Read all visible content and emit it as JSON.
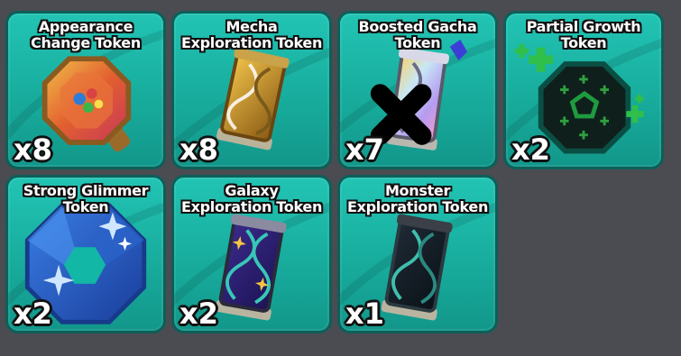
{
  "inventory": {
    "items": [
      {
        "name_line1": "Appearance",
        "name_line2": "Change Token",
        "count": "x8",
        "icon": "rainbow-octagon-token-icon"
      },
      {
        "name_line1": "Mecha",
        "name_line2": "Exploration Token",
        "count": "x8",
        "icon": "golden-dna-capsule-icon"
      },
      {
        "name_line1": "Boosted Gacha",
        "name_line2": "Token",
        "count": "x7",
        "icon": "holographic-dna-capsule-icon"
      },
      {
        "name_line1": "Partial Growth",
        "name_line2": "Token",
        "count": "x2",
        "icon": "green-plus-octagon-icon"
      },
      {
        "name_line1": "Strong Glimmer",
        "name_line2": "Token",
        "count": "x2",
        "icon": "blue-crystal-octagon-icon"
      },
      {
        "name_line1": "Galaxy",
        "name_line2": "Exploration Token",
        "count": "x2",
        "icon": "galaxy-dna-capsule-icon"
      },
      {
        "name_line1": "Monster",
        "name_line2": "Exploration Token",
        "count": "x1",
        "icon": "dark-dna-capsule-icon"
      }
    ]
  },
  "colors": {
    "card_bg": "#19b3a4",
    "card_border": "#0d5f58",
    "page_bg": "#4b4b52"
  }
}
